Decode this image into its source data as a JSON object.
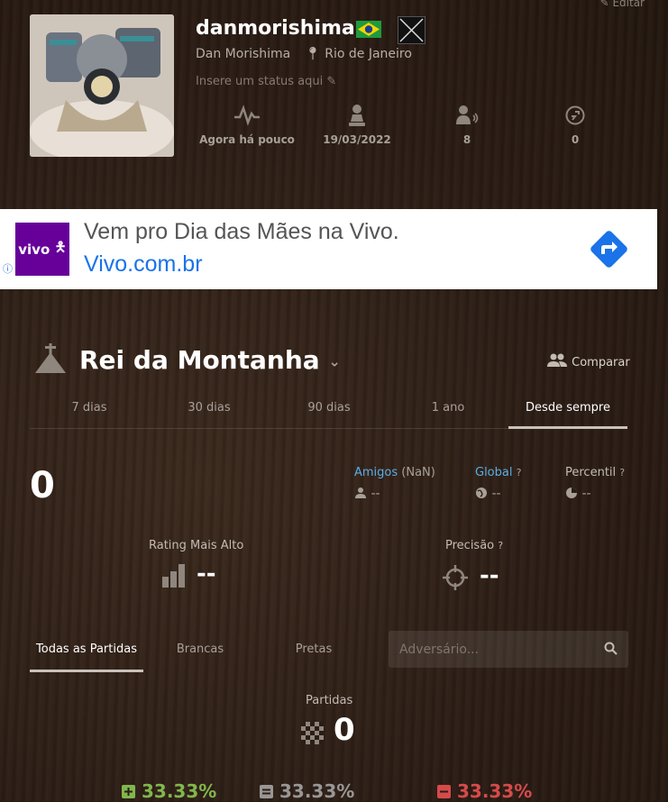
{
  "header": {
    "edit_label": "Editar",
    "username": "danmorishima",
    "real_name": "Dan Morishima",
    "location": "Rio de Janeiro",
    "status_placeholder": "Insere um status aqui",
    "stats": [
      {
        "icon": "activity-icon",
        "value": "Agora há pouco"
      },
      {
        "icon": "pawn-icon",
        "value": "19/03/2022"
      },
      {
        "icon": "friends-icon",
        "value": "8"
      },
      {
        "icon": "points-icon",
        "value": "0"
      }
    ]
  },
  "ad": {
    "logo_text": "vivo",
    "title": "Vem pro Dia das Mães na Vivo.",
    "url": "Vivo.com.br",
    "info_icon": "ⓘ"
  },
  "mode": {
    "title": "Rei da Montanha",
    "compare_label": "Comparar",
    "period_tabs": [
      "7 dias",
      "30 dias",
      "90 dias",
      "1 ano",
      "Desde sempre"
    ],
    "active_period": "Desde sempre"
  },
  "rating": {
    "current": "0",
    "friends_label": "Amigos",
    "friends_extra": "(NaN)",
    "friends_value": "--",
    "global_label": "Global",
    "global_value": "--",
    "percentile_label": "Percentil",
    "percentile_value": "--",
    "highest_label": "Rating Mais Alto",
    "highest_value": "--",
    "precision_label": "Precisão",
    "precision_value": "--"
  },
  "games": {
    "tabs": [
      "Todas as Partidas",
      "Brancas",
      "Pretas"
    ],
    "active_tab": "Todas as Partidas",
    "search_placeholder": "Adversário...",
    "count_label": "Partidas",
    "count_value": "0",
    "win_pct": "33.33%",
    "draw_pct": "33.33%",
    "loss_pct": "33.33%"
  },
  "colors": {
    "accent_blue": "#5aaee6",
    "win": "#81b64c",
    "draw": "#989795",
    "loss": "#d64a4a",
    "ad_purple": "#660099",
    "ad_blue": "#1a73e8"
  }
}
